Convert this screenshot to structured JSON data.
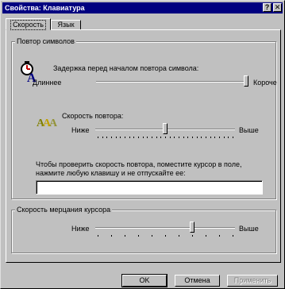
{
  "window": {
    "title": "Свойства: Клавиатура",
    "help_glyph": "?",
    "close_glyph": "✕"
  },
  "tabs": [
    {
      "label": "Скорость",
      "selected": true
    },
    {
      "label": "Язык",
      "selected": false
    }
  ],
  "repeat_group": {
    "title": "Повтор символов",
    "delay": {
      "label": "Задержка перед началом повтора символа:",
      "min_label": "Длиннее",
      "max_label": "Короче",
      "level": 1.0,
      "icon": "delay-icon"
    },
    "rate": {
      "label": "Скорость повтора:",
      "min_label": "Ниже",
      "max_label": "Выше",
      "level": 0.5,
      "icon": "repeat-rate-icon"
    },
    "test_instructions": "Чтобы проверить скорость повтора, поместите курсор в поле, нажмите любую клавишу и не отпускайте ее:",
    "test_value": ""
  },
  "blink_group": {
    "title": "Скорость мерцания курсора",
    "min_label": "Ниже",
    "max_label": "Выше",
    "level": 0.7
  },
  "buttons": {
    "ok": "OK",
    "cancel": "Отмена",
    "apply": "Применить"
  },
  "colors": {
    "title_bar": "#000080",
    "face": "#c0c0c0"
  }
}
